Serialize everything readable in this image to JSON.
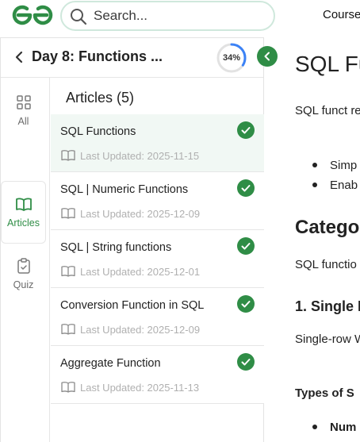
{
  "header": {
    "search_placeholder": "Search...",
    "courses_label": "Courses"
  },
  "sidebar": {
    "back_label": "back",
    "day_title": "Day 8: Functions ...",
    "progress_percent": 34,
    "progress_label": "34%",
    "tabs": [
      {
        "label": "All"
      },
      {
        "label": "Articles"
      },
      {
        "label": "Quiz"
      }
    ],
    "articles_heading": "Articles (5)",
    "articles": [
      {
        "title": "SQL Functions",
        "updated": "Last Updated: 2025-11-15",
        "completed": true
      },
      {
        "title": "SQL | Numeric Functions",
        "updated": "Last Updated: 2025-12-09",
        "completed": true
      },
      {
        "title": "SQL | String functions",
        "updated": "Last Updated: 2025-12-01",
        "completed": true
      },
      {
        "title": "Conversion Function in SQL",
        "updated": "Last Updated: 2025-12-09",
        "completed": true
      },
      {
        "title": "Aggregate Function",
        "updated": "Last Updated: 2025-11-13",
        "completed": true
      }
    ]
  },
  "content": {
    "title": "SQL Fu",
    "para1": "SQL funct results in c",
    "bullets": [
      "Simp",
      "Enab"
    ],
    "h2": "Catego",
    "para2": "SQL functio",
    "h3": "1. Single R",
    "para3": "Single-row WHERE cla",
    "h4": "Types of S",
    "bullets2": [
      "Num"
    ]
  },
  "colors": {
    "brand_green": "#2f8d46",
    "active_row_bg": "#f1f8f4",
    "progress_track": "#e2e2e2",
    "progress_fill": "#3b82f6"
  }
}
